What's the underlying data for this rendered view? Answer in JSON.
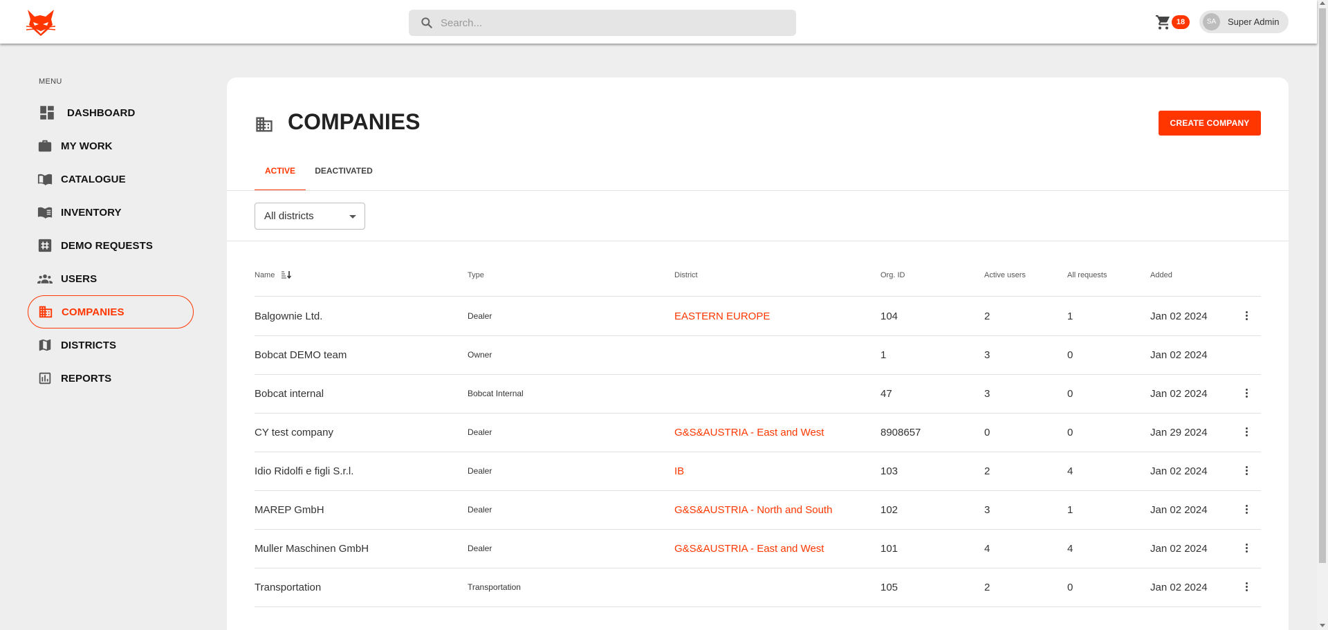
{
  "header": {
    "search_placeholder": "Search...",
    "cart_count": "18",
    "user_initials": "SA",
    "user_name": "Super Admin"
  },
  "sidebar": {
    "menu_label": "MENU",
    "items": [
      {
        "label": "DASHBOARD",
        "icon": "dashboard-icon"
      },
      {
        "label": "MY WORK",
        "icon": "briefcase-icon"
      },
      {
        "label": "CATALOGUE",
        "icon": "book-open-icon"
      },
      {
        "label": "INVENTORY",
        "icon": "book-list-icon"
      },
      {
        "label": "DEMO REQUESTS",
        "icon": "hash-box-icon"
      },
      {
        "label": "USERS",
        "icon": "users-icon"
      },
      {
        "label": "COMPANIES",
        "icon": "building-icon",
        "active": true
      },
      {
        "label": "DISTRICTS",
        "icon": "map-icon"
      },
      {
        "label": "REPORTS",
        "icon": "bar-chart-icon"
      }
    ]
  },
  "page": {
    "title": "COMPANIES",
    "create_button": "CREATE COMPANY",
    "tabs": [
      "ACTIVE",
      "DEACTIVATED"
    ],
    "district_filter": "All districts"
  },
  "table": {
    "columns": [
      "Name",
      "Type",
      "District",
      "Org. ID",
      "Active users",
      "All requests",
      "Added"
    ],
    "rows": [
      {
        "name": "Balgownie Ltd.",
        "type": "Dealer",
        "district": "EASTERN EUROPE",
        "org_id": "104",
        "active_users": "2",
        "all_requests": "1",
        "added": "Jan 02 2024",
        "menu": true
      },
      {
        "name": "Bobcat DEMO team",
        "type": "Owner",
        "district": "",
        "org_id": "1",
        "active_users": "3",
        "all_requests": "0",
        "added": "Jan 02 2024",
        "menu": false
      },
      {
        "name": "Bobcat internal",
        "type": "Bobcat Internal",
        "district": "",
        "org_id": "47",
        "active_users": "3",
        "all_requests": "0",
        "added": "Jan 02 2024",
        "menu": true
      },
      {
        "name": "CY test company",
        "type": "Dealer",
        "district": "G&S&AUSTRIA - East and West",
        "org_id": "8908657",
        "active_users": "0",
        "all_requests": "0",
        "added": "Jan 29 2024",
        "menu": true
      },
      {
        "name": "Idio Ridolfi e figli S.r.l.",
        "type": "Dealer",
        "district": "IB",
        "org_id": "103",
        "active_users": "2",
        "all_requests": "4",
        "added": "Jan 02 2024",
        "menu": true
      },
      {
        "name": "MAREP GmbH",
        "type": "Dealer",
        "district": "G&S&AUSTRIA - North and South",
        "org_id": "102",
        "active_users": "3",
        "all_requests": "1",
        "added": "Jan 02 2024",
        "menu": true
      },
      {
        "name": "Muller Maschinen GmbH",
        "type": "Dealer",
        "district": "G&S&AUSTRIA - East and West",
        "org_id": "101",
        "active_users": "4",
        "all_requests": "4",
        "added": "Jan 02 2024",
        "menu": true
      },
      {
        "name": "Transportation",
        "type": "Transportation",
        "district": "",
        "org_id": "105",
        "active_users": "2",
        "all_requests": "0",
        "added": "Jan 02 2024",
        "menu": true
      }
    ]
  },
  "colors": {
    "accent": "#ff3600",
    "background": "#eeeeee"
  }
}
